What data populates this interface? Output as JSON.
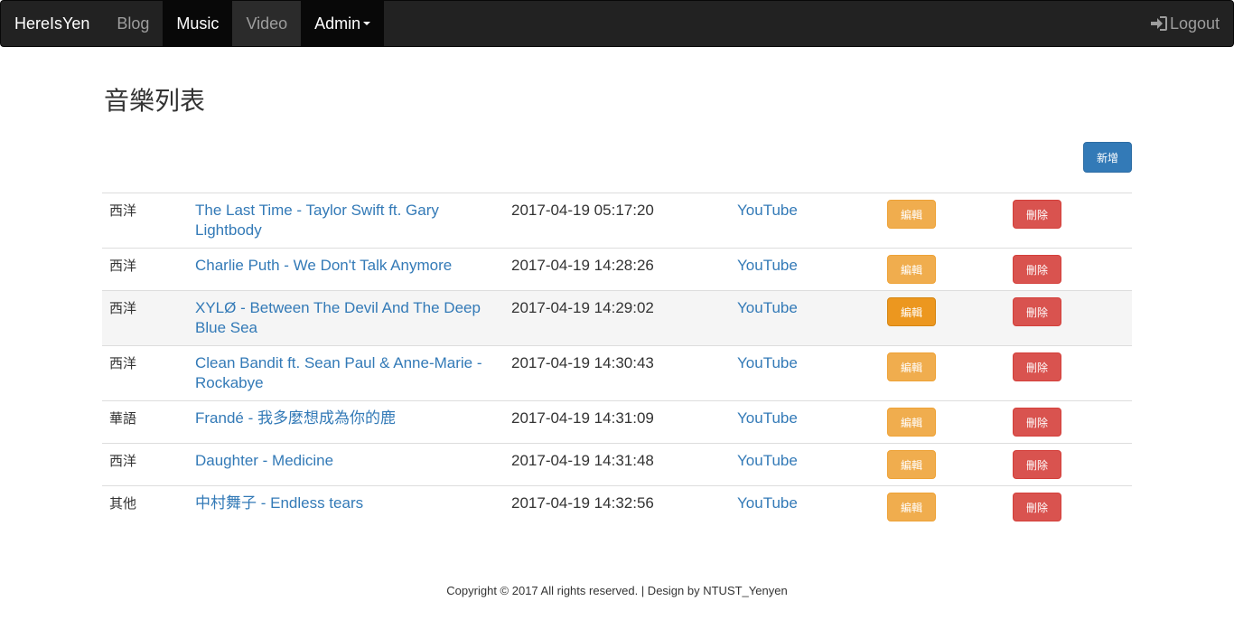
{
  "nav": {
    "brand": "HereIsYen",
    "items": [
      {
        "label": "Blog"
      },
      {
        "label": "Music"
      },
      {
        "label": "Video"
      },
      {
        "label": "Admin"
      }
    ],
    "logout": "Logout"
  },
  "page": {
    "title": "音樂列表",
    "add_button": "新增"
  },
  "music": {
    "rows": [
      {
        "category": "西洋",
        "title": "The Last Time - Taylor Swift ft. Gary Lightbody",
        "date": "2017-04-19 05:17:20",
        "source": "YouTube",
        "edit": "編輯",
        "delete": "刪除"
      },
      {
        "category": "西洋",
        "title": "Charlie Puth - We Don't Talk Anymore",
        "date": "2017-04-19 14:28:26",
        "source": "YouTube",
        "edit": "編輯",
        "delete": "刪除"
      },
      {
        "category": "西洋",
        "title": "XYLØ - Between The Devil And The Deep Blue Sea",
        "date": "2017-04-19 14:29:02",
        "source": "YouTube",
        "edit": "編輯",
        "delete": "刪除"
      },
      {
        "category": "西洋",
        "title": "Clean Bandit ft. Sean Paul & Anne-Marie - Rockabye",
        "date": "2017-04-19 14:30:43",
        "source": "YouTube",
        "edit": "編輯",
        "delete": "刪除"
      },
      {
        "category": "華語",
        "title": "Frandé - 我多麼想成為你的鹿",
        "date": "2017-04-19 14:31:09",
        "source": "YouTube",
        "edit": "編輯",
        "delete": "刪除"
      },
      {
        "category": "西洋",
        "title": "Daughter - Medicine",
        "date": "2017-04-19 14:31:48",
        "source": "YouTube",
        "edit": "編輯",
        "delete": "刪除"
      },
      {
        "category": "其他",
        "title": "中村舞子 - Endless tears",
        "date": "2017-04-19 14:32:56",
        "source": "YouTube",
        "edit": "編輯",
        "delete": "刪除"
      }
    ]
  },
  "footer": {
    "text": "Copyright © 2017 All rights reserved. | Design by NTUST_Yenyen"
  }
}
